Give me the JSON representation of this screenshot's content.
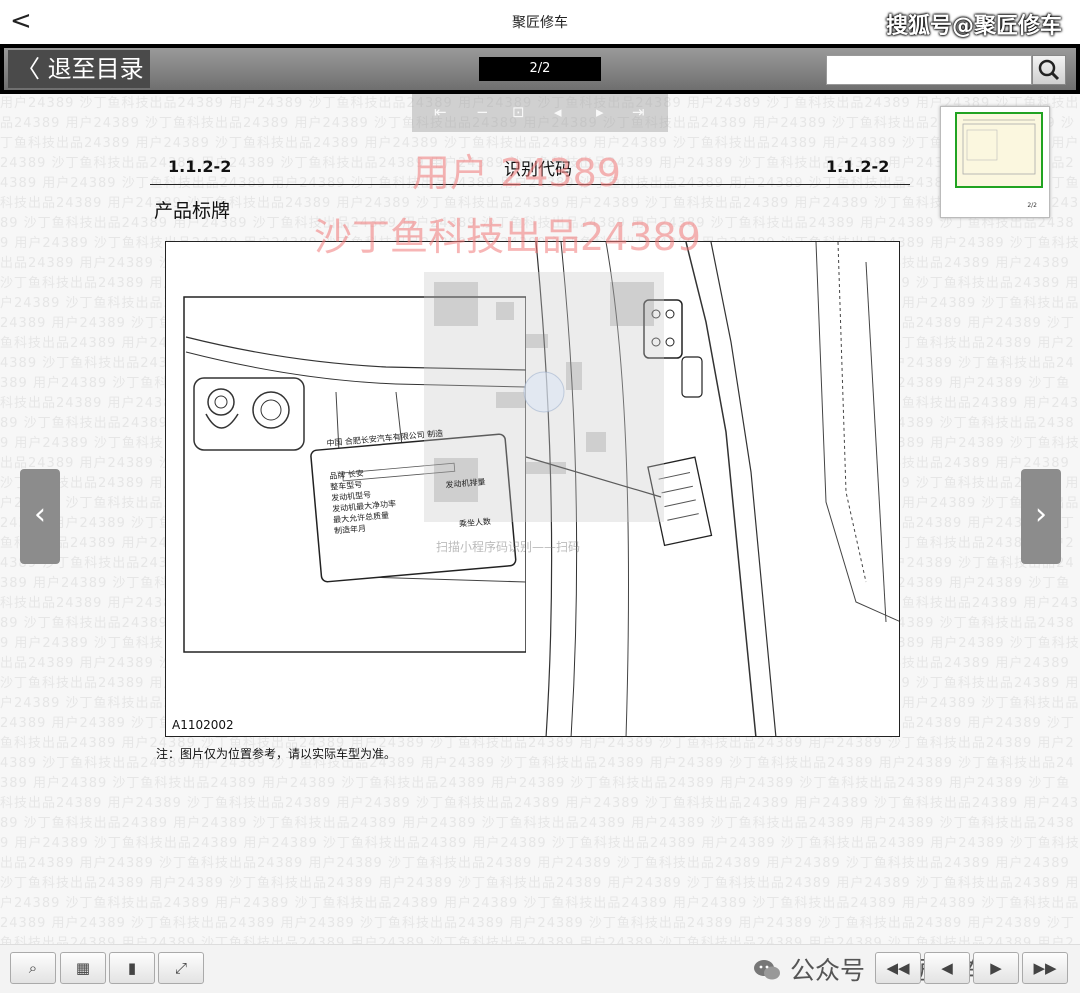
{
  "topbar": {
    "back_icon": "chevron-left-icon",
    "back_glyph": "<",
    "title": "聚匠修车",
    "watermark": "搜狐号@聚匠修车"
  },
  "toolbar": {
    "return_label": "〈 退至目录",
    "page_indicator": "2/2",
    "search_placeholder": "",
    "search_icon": "search-icon"
  },
  "float_nav": {
    "items": [
      "first-page-icon",
      "zoom-out-icon",
      "zoom-fit-icon",
      "prev-page-icon",
      "next-page-icon",
      "last-page-icon"
    ]
  },
  "document": {
    "code_left": "1.1.2-2",
    "title": "识别代码",
    "code_right": "1.1.2-2",
    "section": "产品标牌",
    "figure_code": "A1102002",
    "note": "注：图片仅为位置参考，请以实际车型为准。",
    "watermark_line1": "用户   24389",
    "watermark_line2": "沙丁鱼科技出品24389",
    "plate": {
      "header": "中国    合肥长安汽车有限公司  制造",
      "fields": [
        "品牌 长安",
        "整车型号",
        "发动机型号",
        "发动机最大净功率",
        "最大允许总质量",
        "制造年月"
      ],
      "engine_no": "发动机排量",
      "passengers": "乘坐人数"
    },
    "qr_text": "扫描小程序码识别——扫码"
  },
  "thumbnail": {
    "page_number": "2/2"
  },
  "nav": {
    "prev_icon": "chevron-left-icon",
    "prev_glyph": "‹",
    "next_icon": "chevron-right-icon",
    "next_glyph": "›"
  },
  "bottombar": {
    "left_buttons": [
      "zoom-icon",
      "grid-icon",
      "bookmark-icon",
      "fullscreen-icon"
    ],
    "right_buttons": [
      "first-page-icon",
      "prev-page-icon",
      "next-page-icon",
      "last-page-icon"
    ],
    "watermark": "公众号 · 聚匠修车"
  },
  "background_text": "用户24389 沙丁鱼科技出品24389 "
}
